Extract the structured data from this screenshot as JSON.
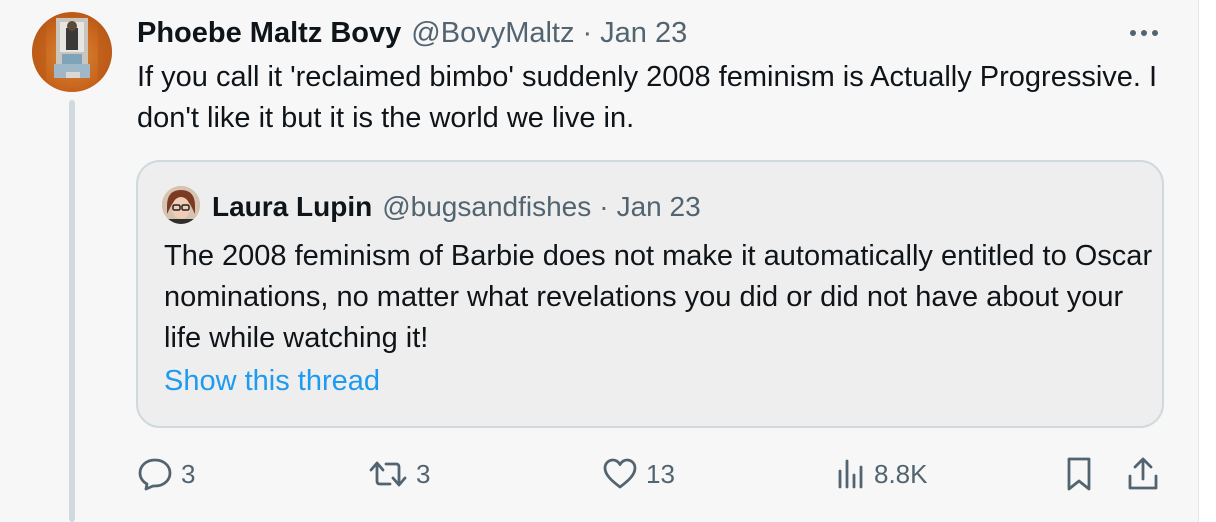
{
  "tweet": {
    "author_name": "Phoebe Maltz Bovy",
    "handle": "@BovyMaltz",
    "separator": "·",
    "date": "Jan 23",
    "more_icon": "more-icon",
    "text": "If you call it 'reclaimed bimbo' suddenly 2008 feminism is Actually Progressive. I don't like it but it is the world we live in."
  },
  "quoted_tweet": {
    "author_name": "Laura Lupin",
    "handle": "@bugsandfishes",
    "separator": "·",
    "date": "Jan 23",
    "text": "The 2008 feminism of Barbie does not make it automatically entitled to Oscar nominations, no matter what revelations you did or did not have about your life while watching it!",
    "show_thread_label": "Show this thread"
  },
  "actions": {
    "reply_count": "3",
    "retweet_count": "3",
    "like_count": "13",
    "views_count": "8.8K",
    "icons": [
      "reply-icon",
      "retweet-icon",
      "like-icon",
      "views-icon",
      "bookmark-icon",
      "share-icon"
    ]
  },
  "colors": {
    "text": "#0f1419",
    "secondary": "#536471",
    "link": "#1d9bf0",
    "border": "#cfd9de",
    "background": "#f7f7f7"
  }
}
